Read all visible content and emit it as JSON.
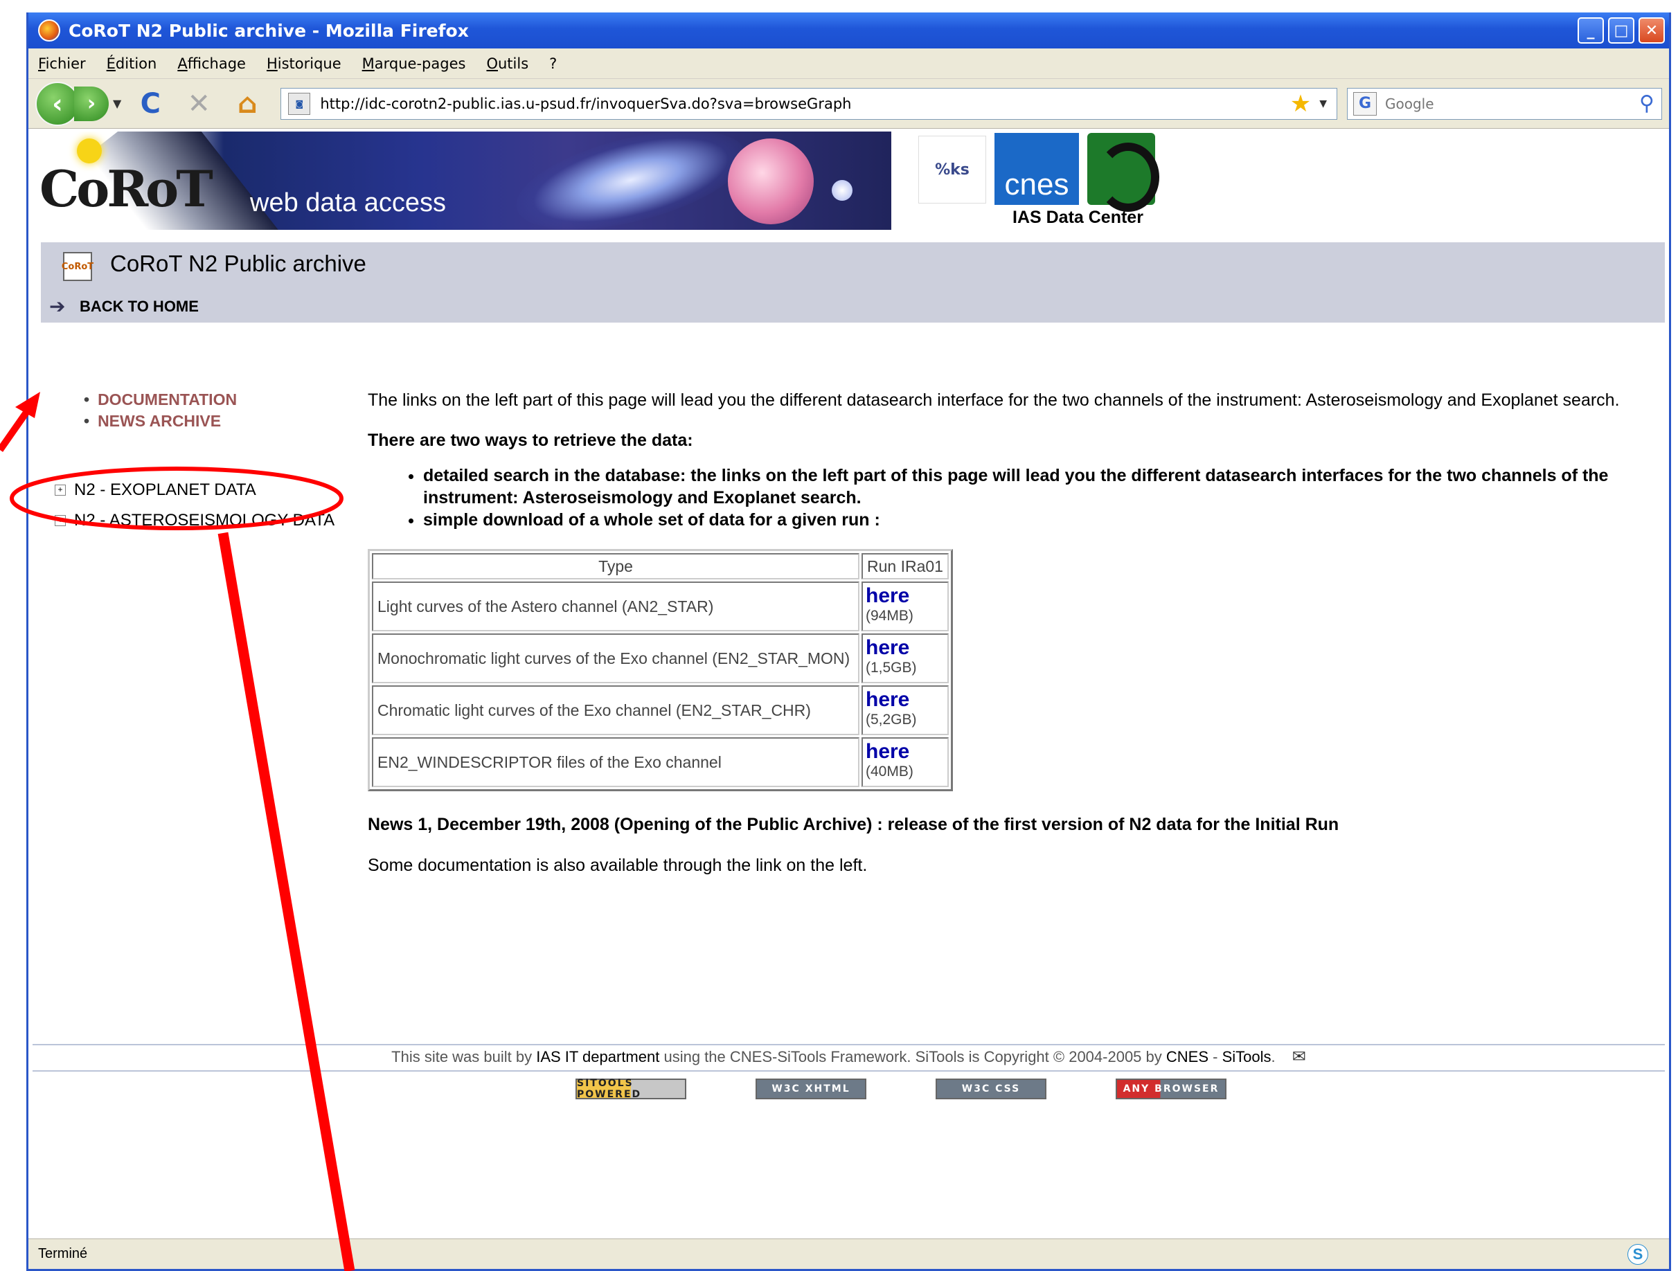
{
  "window": {
    "title": "CoRoT N2 Public archive - Mozilla Firefox",
    "controls": [
      "_",
      "□",
      "✕"
    ]
  },
  "menu": [
    "Fichier",
    "Édition",
    "Affichage",
    "Historique",
    "Marque-pages",
    "Outils",
    "?"
  ],
  "nav": {
    "back": "‹",
    "forward": "›",
    "reload": "C",
    "stop": "✕",
    "home": "⌂",
    "url": "http://idc-corotn2-public.ias.u-psud.fr/invoquerSva.do?sva=browseGraph",
    "search_engine": "G",
    "search_placeholder": "Google"
  },
  "banner": {
    "logo": "CoRoT",
    "text": "web data access",
    "ks_logo": "%ks",
    "cnes_logo": "cnes",
    "data_center": "IAS Data Center"
  },
  "header": {
    "icon": "CoRoT",
    "title": "CoRoT N2 Public archive",
    "back_home": "BACK TO HOME"
  },
  "sidebar": {
    "links": [
      "DOCUMENTATION",
      "NEWS ARCHIVE"
    ],
    "tree": [
      "N2 - EXOPLANET DATA",
      "N2 - ASTEROSEISMOLOGY DATA"
    ]
  },
  "content": {
    "intro": "The links on the left part of this page will lead you the different datasearch interface for the two channels of the instrument: Asteroseismology and Exoplanet search.",
    "ways": "There are two ways to retrieve the data:",
    "bullets": [
      "detailed search in the database: the links on the left part of this page will lead you the different datasearch interfaces for the two channels of the instrument: Asteroseismology and Exoplanet search.",
      "simple download of a whole set of data for a given run :"
    ],
    "table": {
      "headers": [
        "Type",
        "Run IRa01"
      ],
      "rows": [
        {
          "type": "Light curves of the Astero channel (AN2_STAR)",
          "link": "here",
          "size": "(94MB)"
        },
        {
          "type": "Monochromatic light curves of the Exo channel (EN2_STAR_MON)",
          "link": "here",
          "size": "(1,5GB)"
        },
        {
          "type": "Chromatic light curves of the Exo channel (EN2_STAR_CHR)",
          "link": "here",
          "size": "(5,2GB)"
        },
        {
          "type": "EN2_WINDESCRIPTOR files of the Exo channel",
          "link": "here",
          "size": "(40MB)"
        }
      ]
    },
    "news": "News 1, December 19th, 2008 (Opening of the Public Archive) : release of the first version of N2 data for the Initial Run",
    "more_doc": "Some documentation is also available through the link on the left."
  },
  "footer": {
    "pre": "This site was built by ",
    "ias": "IAS IT department",
    "mid": " using the CNES-SiTools Framework. SiTools is Copyright © 2004-2005 by ",
    "cnes": "CNES",
    "sep": " - ",
    "sitools": "SiTools",
    "end": ".",
    "badges": [
      "SITOOLS POWERED",
      "W3C XHTML",
      "W3C CSS",
      "ANY BROWSER"
    ]
  },
  "status": {
    "text": "Terminé",
    "skype": "S"
  },
  "annotation": {
    "color": "#ff0000"
  }
}
